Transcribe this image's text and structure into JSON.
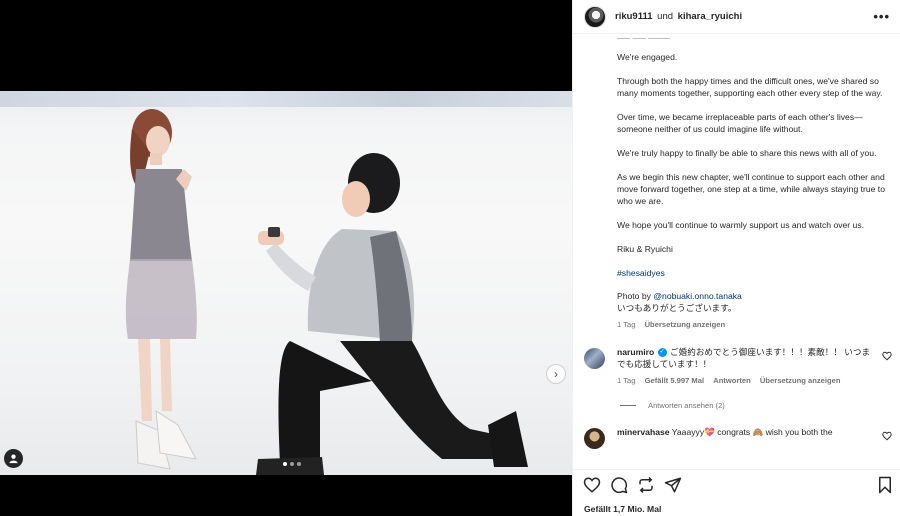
{
  "post": {
    "header": {
      "author1": "riku9111",
      "connector": "und",
      "author2": "kihara_ryuichi",
      "more_label": "•••"
    },
    "caption": {
      "cutoff_line": "___ ___ _____",
      "paragraphs": [
        "We're engaged.",
        "Through both the happy times and the difficult ones, we've shared so many moments together, supporting each other every step of the way.",
        "Over time, we became irreplaceable parts of each other's lives—someone neither of us could imagine life without.",
        "We're truly happy to finally be able to share this news with all of you.",
        "As we begin this new chapter, we'll continue to support each other and move forward together, one step at a time, while always staying true to who we are.",
        "We hope you'll continue to warmly support us and watch over us.",
        "Riku & Ryuichi"
      ],
      "hashtag": "#shesaidyes",
      "photo_by_prefix": "Photo by ",
      "photo_by_handle": "@nobuaki.onno.tanaka",
      "japanese_line": "いつもありがとうございます。",
      "time": "1 Tag",
      "translate": "Übersetzung anzeigen"
    },
    "comments": [
      {
        "user": "narumiro",
        "text": "ご婚約おめでとう御座います！！！素敵！！ いつまでも応援しています！！",
        "time": "1 Tag",
        "likes": "Gefällt 5.997 Mal",
        "reply": "Antworten",
        "translate": "Übersetzung anzeigen",
        "view_replies": "Antworten ansehen (2)"
      },
      {
        "user": "minervahase",
        "text": "Yaaayyy💝 congrats 🙈 wish you both the"
      }
    ],
    "likes_total": "Gefällt 1,7 Mio. Mal"
  },
  "carousel": {
    "slide_count": 3,
    "active_index": 0
  },
  "colors": {
    "link": "#00376b",
    "verified": "#0095f6",
    "muted": "#737373"
  },
  "icons": [
    "heart-icon",
    "comment-icon",
    "share-icon",
    "send-icon",
    "bookmark-icon",
    "more-icon",
    "user-tag-icon",
    "chevron-right-icon"
  ]
}
